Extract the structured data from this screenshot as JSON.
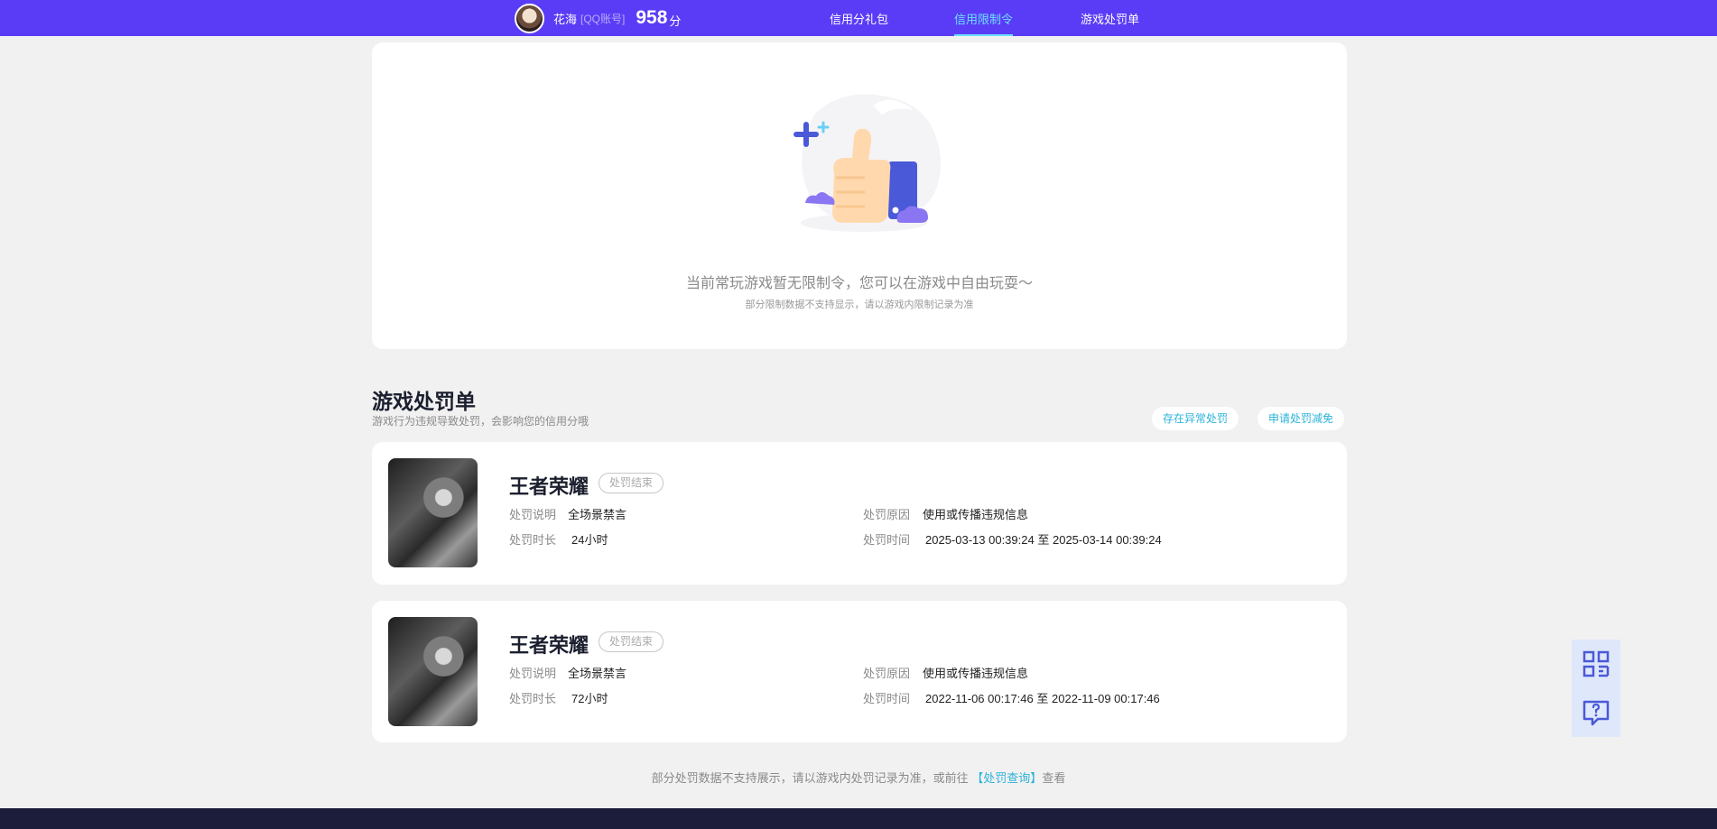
{
  "header": {
    "user_name": "花海",
    "account_tag": "[QQ账号]",
    "score": "958",
    "score_unit": "分",
    "nav": [
      {
        "label": "信用分礼包"
      },
      {
        "label": "信用限制令"
      },
      {
        "label": "游戏处罚单"
      }
    ]
  },
  "empty_state": {
    "message": "当前常玩游戏暂无限制令，您可以在游戏中自由玩耍～",
    "sub": "部分限制数据不支持显示，请以游戏内限制记录为准"
  },
  "section": {
    "title": "游戏处罚单",
    "subtitle": "游戏行为违规导致处罚，会影响您的信用分哦",
    "btn_abnormal": "存在异常处罚",
    "btn_apply": "申请处罚减免"
  },
  "labels": {
    "desc": "处罚说明",
    "duration": "处罚时长",
    "reason": "处罚原因",
    "time": "处罚时间",
    "to": "至"
  },
  "penalties": [
    {
      "game": "王者荣耀",
      "status": "处罚结束",
      "desc": "全场景禁言",
      "duration": "24小时",
      "reason": "使用或传播违规信息",
      "start": "2025-03-13 00:39:24",
      "end": "2025-03-14 00:39:24"
    },
    {
      "game": "王者荣耀",
      "status": "处罚结束",
      "desc": "全场景禁言",
      "duration": "72小时",
      "reason": "使用或传播违规信息",
      "start": "2022-11-06 00:17:46",
      "end": "2022-11-09 00:17:46"
    }
  ],
  "footnote": {
    "prefix": "部分处罚数据不支持展示，请以游戏内处罚记录为准，或前往",
    "link": "【处罚查询】",
    "suffix": "查看"
  },
  "colors": {
    "topbar": "#5b3cf6",
    "accent": "#2bb3d9",
    "active_nav": "#6ce0ff",
    "footer": "#1b1d3a"
  },
  "icons": {
    "qr": "qr-code-icon",
    "feedback": "feedback-question-icon"
  }
}
